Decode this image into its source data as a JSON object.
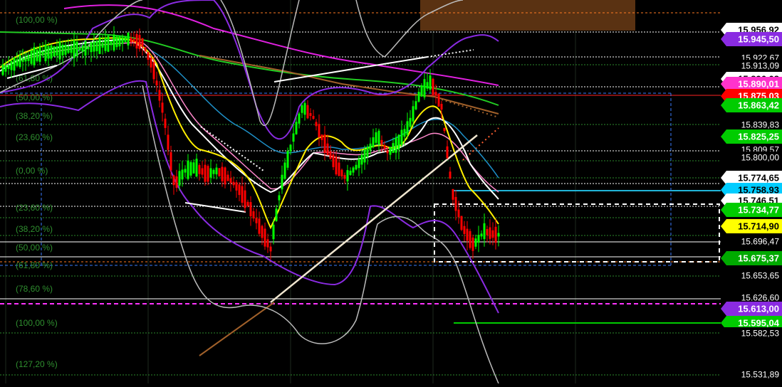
{
  "chart_data": {
    "type": "candlestick",
    "price_axis_labels": [
      {
        "value": 15956.92,
        "text": "15.956,92",
        "bg": "#ffffff",
        "fg": "#000000"
      },
      {
        "value": 15945.5,
        "text": "15.945,50",
        "bg": "#8a2be2",
        "fg": "#ffffff"
      },
      {
        "value": 15922.67,
        "text": "15.922,67",
        "bg": "#000000",
        "fg": "#ffffff"
      },
      {
        "value": 15913.09,
        "text": "15.913,09",
        "bg": "#000000",
        "fg": "#ffffff"
      },
      {
        "value": 15896.08,
        "text": "15.896,08",
        "bg": "#ffffff",
        "fg": "#000000"
      },
      {
        "value": 15890.01,
        "text": "15.890,01",
        "bg": "#ff33cc",
        "fg": "#ffffff"
      },
      {
        "value": 15875.03,
        "text": "15.875,03",
        "bg": "#ff0000",
        "fg": "#ffffff"
      },
      {
        "value": 15863.42,
        "text": "15.863,42",
        "bg": "#00cc00",
        "fg": "#ffffff"
      },
      {
        "value": 15839.83,
        "text": "15.839,83",
        "bg": "#000000",
        "fg": "#ffffff"
      },
      {
        "value": 15825.25,
        "text": "15.825,25",
        "bg": "#00cc00",
        "fg": "#ffffff"
      },
      {
        "value": 15809.57,
        "text": "15.809,57",
        "bg": "#000000",
        "fg": "#ffffff"
      },
      {
        "value": 15800.0,
        "text": "15.800,00",
        "bg": "#000000",
        "fg": "#ffffff"
      },
      {
        "value": 15774.65,
        "text": "15.774,65",
        "bg": "#ffffff",
        "fg": "#000000"
      },
      {
        "value": 15758.93,
        "text": "15.758,93",
        "bg": "#00ccff",
        "fg": "#000000"
      },
      {
        "value": 15746.51,
        "text": "15.746,51",
        "bg": "#ffffff",
        "fg": "#000000"
      },
      {
        "value": 15734.77,
        "text": "15.734,77",
        "bg": "#00cc00",
        "fg": "#ffffff"
      },
      {
        "value": 15714.9,
        "text": "15.714,90",
        "bg": "#ffff00",
        "fg": "#000000"
      },
      {
        "value": 15696.47,
        "text": "15.696,47",
        "bg": "#000000",
        "fg": "#ffffff"
      },
      {
        "value": 15675.37,
        "text": "15.675,37",
        "bg": "#00aa00",
        "fg": "#ffffff"
      },
      {
        "value": 15653.65,
        "text": "15.653,65",
        "bg": "#000000",
        "fg": "#ffffff"
      },
      {
        "value": 15626.6,
        "text": "15.626,60",
        "bg": "#000000",
        "fg": "#ffffff"
      },
      {
        "value": 15613.0,
        "text": "15.613,00",
        "bg": "#8a2be2",
        "fg": "#ffffff"
      },
      {
        "value": 15595.04,
        "text": "15.595,04",
        "bg": "#00cc00",
        "fg": "#ffffff"
      },
      {
        "value": 15582.53,
        "text": "15.582,53",
        "bg": "#000000",
        "fg": "#ffffff"
      },
      {
        "value": 15531.89,
        "text": "15.531,89",
        "bg": "#000000",
        "fg": "#ffffff"
      }
    ],
    "fib_levels": [
      {
        "label": "(100,00 %)",
        "value": 15956.92
      },
      {
        "label": "(78,60 %)",
        "value": 15922.67
      },
      {
        "label": "(61,80 %)",
        "value": 15896.08
      },
      {
        "label": "(50,00 %)",
        "value": 15875.03
      },
      {
        "label": "(38,20 %)",
        "value": 15856.4
      },
      {
        "label": "(23,60 %)",
        "value": 15833.4
      },
      {
        "label": "(0,00 %)",
        "value": 15785.0
      },
      {
        "label": "(23,60 %)",
        "value": 15741.6
      },
      {
        "label": "(38,20 %)",
        "value": 15723.0
      },
      {
        "label": "(50,00 %)",
        "value": 15706.8
      },
      {
        "label": "(61,80 %)",
        "value": 15681.9
      },
      {
        "label": "(78,60 %)",
        "value": 15655.5
      },
      {
        "label": "(100,00 %)",
        "value": 15621.0
      },
      {
        "label": "(127,20 %)",
        "value": 15579.0
      }
    ],
    "colors": {
      "background": "#000000",
      "up_candle": "#00ff00",
      "down_candle": "#ff0000",
      "fib_line": "#2b8a2b",
      "fib_label": "#2f8f2f"
    }
  }
}
